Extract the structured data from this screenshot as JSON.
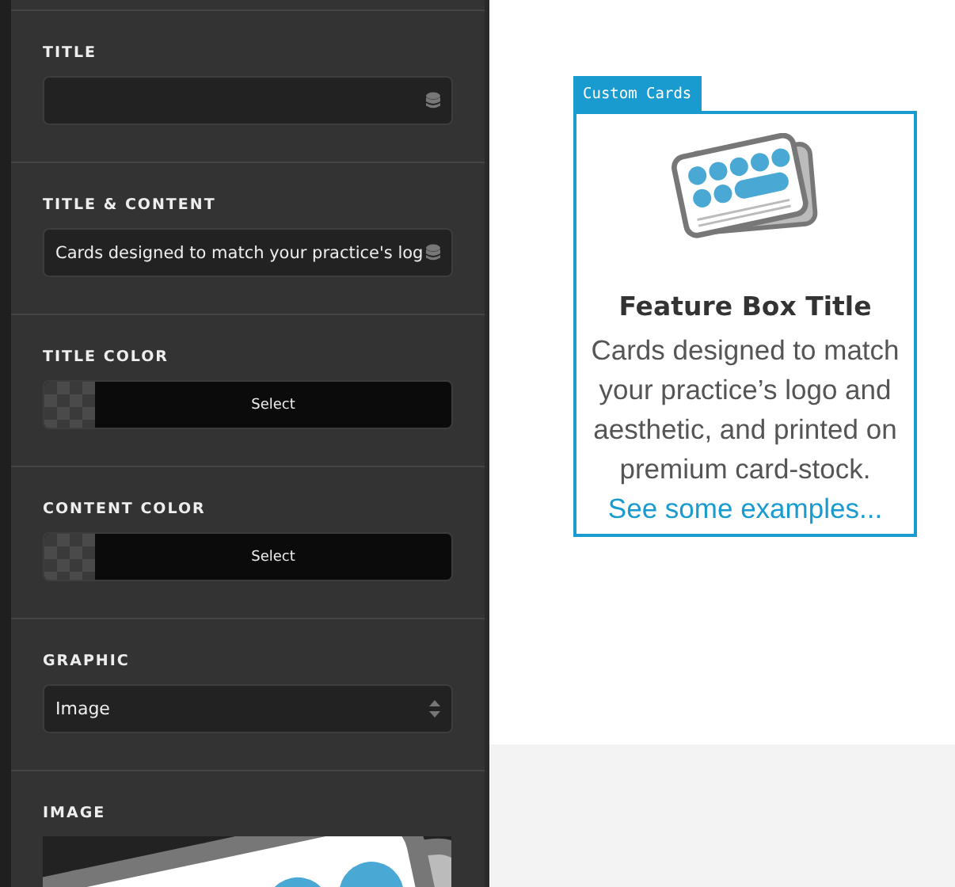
{
  "sidebar": {
    "fields": [
      {
        "kind": "text",
        "label": "TITLE"
      },
      {
        "kind": "text",
        "label": "TITLE & CONTENT",
        "value": "Cards designed to match your practice's log"
      },
      {
        "kind": "color",
        "label": "TITLE COLOR",
        "button": "Select"
      },
      {
        "kind": "color",
        "label": "CONTENT COLOR",
        "button": "Select"
      },
      {
        "kind": "select",
        "label": "GRAPHIC",
        "value": "Image"
      },
      {
        "kind": "image",
        "label": "IMAGE"
      }
    ]
  },
  "preview": {
    "tag": "Custom Cards",
    "title": "Feature Box Title",
    "body": "Cards designed to match your practice’s logo and aesthetic, and printed on premium card-stock.",
    "link": "See some examples..."
  }
}
